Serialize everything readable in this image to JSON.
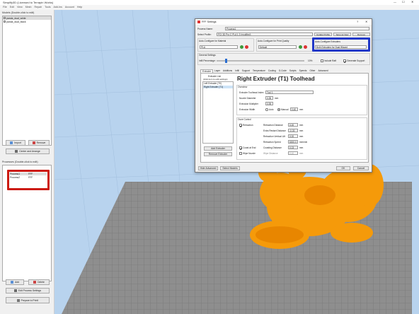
{
  "app": {
    "title": "Simplify3D (Licensed to Terrapin Works)"
  },
  "menu": [
    "File",
    "Edit",
    "View",
    "Mesh",
    "Repair",
    "Tools",
    "Add-Ins",
    "Account",
    "Help"
  ],
  "models": {
    "label": "Models (Double-click to edit)",
    "items": [
      "panda_dual_white",
      "panda_dual_black"
    ],
    "import_label": "Import",
    "remove_label": "Remove",
    "center_label": "Center and Arrange"
  },
  "processes": {
    "label": "Processes (Double-click to edit)",
    "rows": [
      [
        "Process1",
        "FFF"
      ],
      [
        "Process2",
        "FFF"
      ]
    ],
    "add_label": "Add",
    "delete_label": "Delete",
    "edit_label": "Edit Process Settings",
    "prepare_label": "Prepare to Print!"
  },
  "dialog": {
    "title": "FFF Settings",
    "process_name_label": "Process Name:",
    "process_name_value": "Process1",
    "select_profile_label": "Select Profile:",
    "select_profile_value": "PCI 3D Pro C PLA 1.3 (modified)",
    "update_profile_label": "Update Profile",
    "save_profile_label": "Save as New",
    "remove_profile_label": "Remove",
    "auto_material_label": "Auto-Configure for Material",
    "auto_material_value": "PLA",
    "auto_quality_label": "Auto-Configure for Print Quality",
    "auto_quality_value": "Default",
    "auto_extruders_label": "Auto-Configure Extruders",
    "auto_extruders_value": "Both Extruders for Dual Wizard",
    "general_label": "General Settings",
    "infill_label": "Infill Percentage:",
    "infill_value": "10%",
    "include_raft_label": "Include Raft",
    "generate_support_label": "Generate Support",
    "tabs": [
      "Extruder",
      "Layer",
      "Additions",
      "Infill",
      "Support",
      "Temperature",
      "Cooling",
      "G-Code",
      "Scripts",
      "Speeds",
      "Other",
      "Advanced"
    ],
    "extruder_list_label": "Extruder List",
    "extruder_list_hint": "(click item to edit settings)",
    "extruders": [
      "Left Extruder (T0)",
      "Right Extruder (T1)"
    ],
    "add_extruder_label": "Add Extruder",
    "remove_extruder_label": "Remove Extruder",
    "heading": "Right Extruder (T1) Toolhead",
    "overview_label": "Overview",
    "toolhead_index_label": "Extruder Toolhead Index",
    "toolhead_index_value": "Tool 1",
    "nozzle_label": "Nozzle Diameter",
    "nozzle_value": "0.35",
    "nozzle_unit": "mm",
    "multiplier_label": "Extrusion Multiplier",
    "multiplier_value": "0.95",
    "width_label": "Extrusion Width",
    "width_auto": "Auto",
    "width_manual": "Manual",
    "width_value": "0.40",
    "width_unit": "mm",
    "ooze_label": "Ooze Control",
    "retraction_label": "Retraction",
    "coast_label": "Coast at End",
    "wipe_label": "Wipe Nozzle",
    "ooze_rows": [
      {
        "label": "Retraction Distance",
        "value": "0.00",
        "unit": "mm"
      },
      {
        "label": "Extra Restart Distance",
        "value": "-0.03",
        "unit": "mm"
      },
      {
        "label": "Retraction Vertical Lift",
        "value": "0.00",
        "unit": "mm"
      },
      {
        "label": "Retraction Speed",
        "value": "6000.0",
        "unit": "mm/min"
      },
      {
        "label": "Coasting Distance",
        "value": "0.03",
        "unit": "mm"
      },
      {
        "label": "Wipe Distance",
        "value": "0.10",
        "unit": "mm"
      }
    ],
    "hide_advanced_label": "Hide Advanced",
    "select_models_label": "Select Models",
    "ok_label": "OK",
    "cancel_label": "Cancel"
  },
  "colors": {
    "highlight_blue": "#2038c8",
    "highlight_red": "#cc1a10",
    "panda": "#f59a0a",
    "bed": "#8e8e8e",
    "sky": "#b8d3ee"
  }
}
